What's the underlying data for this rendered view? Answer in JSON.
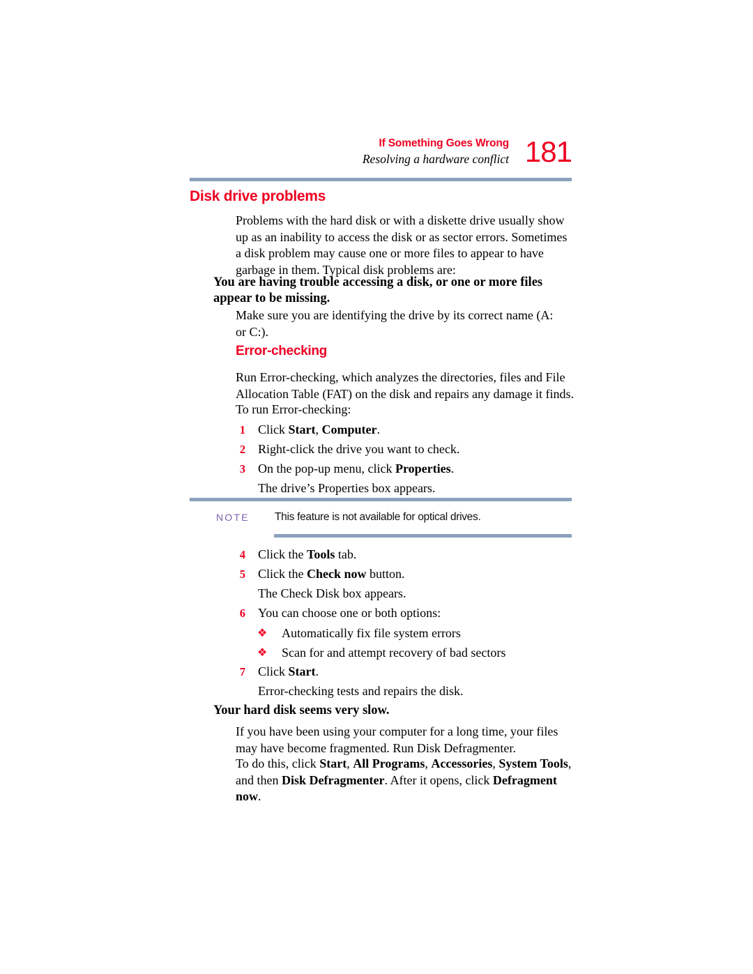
{
  "page": {
    "folio": "181",
    "running_head_title": "If Something Goes Wrong",
    "running_head_subtitle": "Resolving a hardware conflict"
  },
  "colors": {
    "accent_red": "#ee0022",
    "rule_blue": "#8aa0bd",
    "note_label_purple": "#7b63ac",
    "body_text": "#000000"
  },
  "sections": {
    "disk_drive_problems": {
      "heading": "Disk drive problems",
      "intro": "Problems with the hard disk or with a diskette drive usually show up as an inability to access the disk or as sector errors. Sometimes a disk problem may cause one or more files to appear to have garbage in them. Typical disk problems are:",
      "subheading": "You are having trouble accessing a disk, or one or more files appear to be missing.",
      "subheading_body": "Make sure you are identifying the drive by its correct name (A: or C:)."
    },
    "error_checking": {
      "heading": "Error-checking",
      "intro": "Run Error-checking, which analyzes the directories, files and File Allocation Table (FAT) on the disk and repairs any damage it finds.",
      "lead_in": "To run Error-checking:",
      "steps": [
        {
          "num": "1",
          "pre": "Click ",
          "bold1": "Start",
          "mid": ", ",
          "bold2": "Computer",
          "post": "."
        },
        {
          "num": "2",
          "pre": "Right-click the drive you want to check.",
          "bold1": "",
          "mid": "",
          "bold2": "",
          "post": ""
        },
        {
          "num": "3",
          "pre": "On the pop-up menu, click ",
          "bold1": "Properties",
          "mid": "",
          "bold2": "",
          "post": "."
        }
      ],
      "step3_result": "The drive’s Properties box appears.",
      "note": {
        "label": "NOTE",
        "text": "This feature is not available for optical drives."
      },
      "steps_after_note": [
        {
          "num": "4",
          "pre": "Click the ",
          "bold1": "Tools",
          "mid": "",
          "bold2": "",
          "post": " tab."
        },
        {
          "num": "5",
          "pre": "Click the ",
          "bold1": "Check now",
          "mid": "",
          "bold2": "",
          "post": " button."
        }
      ],
      "step5_result": "The Check Disk box appears.",
      "step6": {
        "num": "6",
        "text": "You can choose one or both options:"
      },
      "options": [
        "Automatically fix file system errors",
        "Scan for and attempt recovery of bad sectors"
      ],
      "step7": {
        "num": "7",
        "pre": "Click ",
        "bold1": "Start",
        "post": "."
      },
      "step7_result": "Error-checking tests and repairs the disk."
    },
    "slow_disk": {
      "subheading": "Your hard disk seems very slow.",
      "para1": "If you have been using your computer for a long time, your files may have become fragmented. Run Disk Defragmenter.",
      "para2": {
        "t1": "To do this, click ",
        "b1": "Start",
        "t2": ", ",
        "b2": "All Programs",
        "t3": ", ",
        "b3": "Accessories",
        "t4": ", ",
        "b4": "System Tools",
        "t5": ", and then ",
        "b5": "Disk Defragmenter",
        "t6": ". After it opens, click ",
        "b6": "Defragment now",
        "t7": "."
      }
    }
  },
  "icons": {
    "bullet_glyph": "❖"
  }
}
